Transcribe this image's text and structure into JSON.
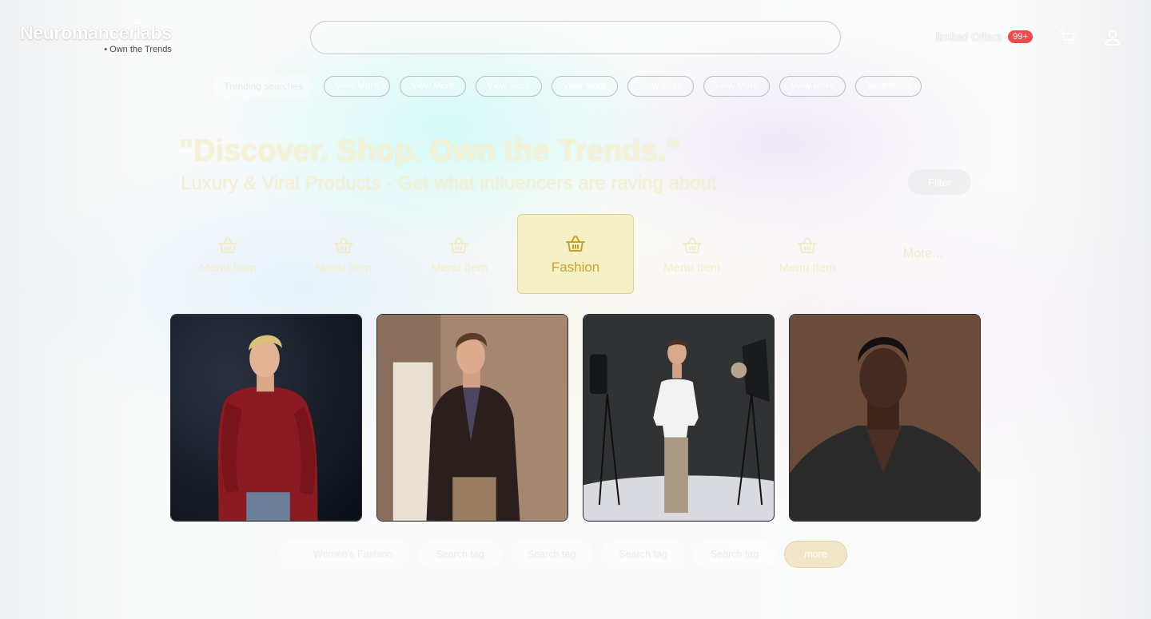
{
  "brand": {
    "name": "Neuromancerlabs",
    "tagline": "Own the Trends"
  },
  "header": {
    "offers_label": "limited Offers",
    "offers_badge": "99+",
    "cart_icon": "cart-icon",
    "user_icon": "user-icon"
  },
  "trending": {
    "label": "Trending searches",
    "pills": [
      "View More",
      "View More",
      "View More",
      "View More",
      "View More",
      "View More",
      "View More",
      "View More"
    ]
  },
  "hero": {
    "title": "\"Discover. Shop. Own the Trends.\"",
    "subtitle": "Luxury & Viral Products - Get what influencers are raving about",
    "filter_label": "Filter"
  },
  "menu": {
    "items": [
      {
        "label": "Menu Item",
        "icon": "basket-icon"
      },
      {
        "label": "Menu Item",
        "icon": "basket-icon"
      },
      {
        "label": "Menu Item",
        "icon": "basket-icon"
      },
      {
        "label": "Fashion",
        "icon": "basket-icon",
        "active": true
      },
      {
        "label": "Menu Item",
        "icon": "basket-icon"
      },
      {
        "label": "Menu Item",
        "icon": "basket-icon"
      }
    ],
    "more_label": "More..."
  },
  "products": [
    {
      "image": "man-red-sweater-photo"
    },
    {
      "image": "man-leather-jacket-photo"
    },
    {
      "image": "man-white-tshirt-studio-photo"
    },
    {
      "image": "man-dark-jacket-portrait-photo"
    }
  ],
  "tags": {
    "items": [
      "Women's Fashion",
      "Search tag",
      "Search tag",
      "Search tag",
      "Search tag"
    ],
    "more_label": "more"
  },
  "colors": {
    "accent": "#c9a323",
    "active_bg": "#f5f0c8",
    "badge": "#f04a4a"
  }
}
